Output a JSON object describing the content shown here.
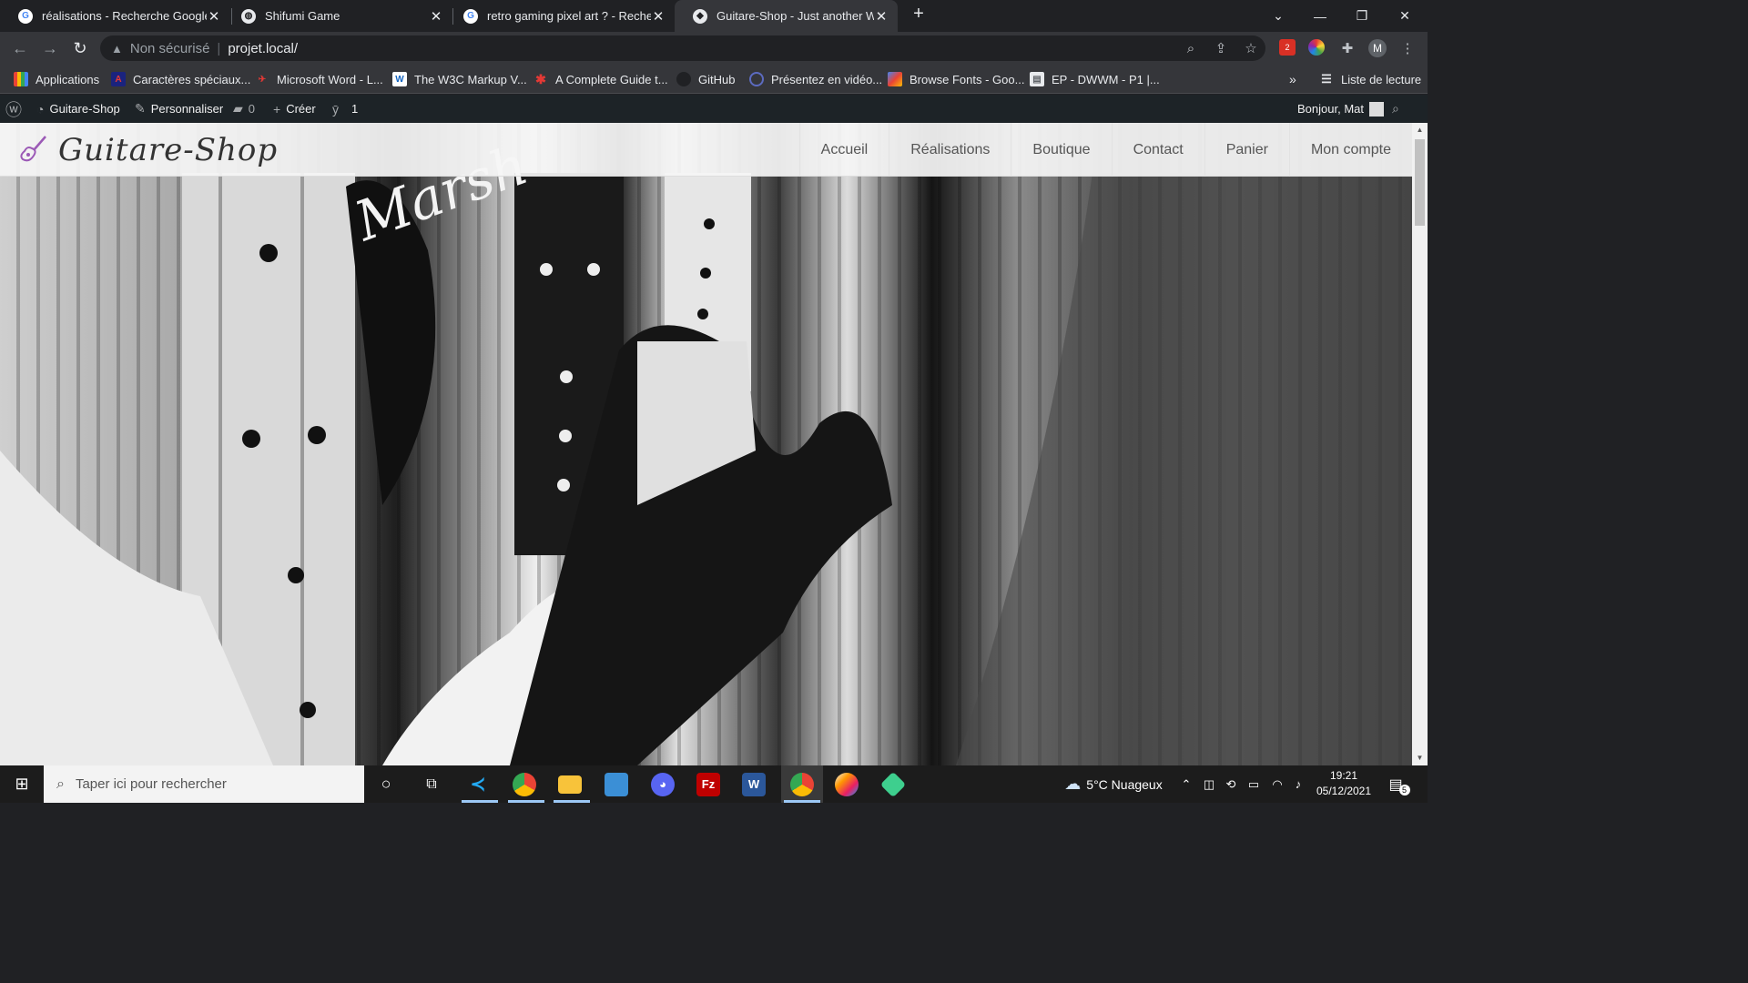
{
  "browser": {
    "tabs": [
      {
        "title": "réalisations - Recherche Google",
        "favicon": "google-icon"
      },
      {
        "title": "Shifumi Game",
        "favicon": "globe-icon"
      },
      {
        "title": "retro gaming pixel art ? - Recherche Google",
        "favicon": "google-icon"
      },
      {
        "title": "Guitare-Shop - Just another WordPress site",
        "favicon": "shield-icon",
        "active": true
      }
    ],
    "new_tab": "+",
    "address": {
      "security_label": "Non sécurisé",
      "url": "projet.local/"
    },
    "bookmarks": [
      {
        "label": "Applications",
        "icon": "apps-grid-icon"
      },
      {
        "label": "Caractères spéciaux...",
        "icon": "letter-a-icon"
      },
      {
        "label": "Microsoft Word - L...",
        "icon": "word-icon"
      },
      {
        "label": "The W3C Markup V...",
        "icon": "w3c-icon"
      },
      {
        "label": "A Complete Guide t...",
        "icon": "star-icon"
      },
      {
        "label": "GitHub",
        "icon": "github-icon"
      },
      {
        "label": "Présentez en vidéo...",
        "icon": "circle-icon"
      },
      {
        "label": "Browse Fonts - Goo...",
        "icon": "fonts-icon"
      },
      {
        "label": "EP - DWWM - P1 |...",
        "icon": "doc-icon"
      }
    ],
    "bookmarks_overflow": "»",
    "reading_list": "Liste de lecture",
    "profile_initial": "M",
    "extension_badge": "2"
  },
  "wp_admin_bar": {
    "site_name": "Guitare-Shop",
    "customize": "Personnaliser",
    "comments_count": "0",
    "new_label": "Créer",
    "yoast_count": "1",
    "greeting": "Bonjour, Mat"
  },
  "site": {
    "logo_text": "Guitare-Shop",
    "nav": [
      "Accueil",
      "Réalisations",
      "Boutique",
      "Contact",
      "Panier",
      "Mon compte"
    ],
    "hero_overlay_text": "Marsh"
  },
  "taskbar": {
    "search_placeholder": "Taper ici pour rechercher",
    "weather": "5°C  Nuageux",
    "time": "19:21",
    "date": "05/12/2021",
    "notification_count": "5",
    "apps": [
      "vscode-icon",
      "chrome-icon",
      "file-explorer-icon",
      "photos-icon",
      "discord-icon",
      "filezilla-icon",
      "word-icon",
      "chrome-profile-icon",
      "paint-icon",
      "app-green-icon"
    ]
  },
  "colors": {
    "browser_dark": "#202124",
    "toolbar": "#35363a",
    "wp_bar": "#1d2327",
    "logo_accent": "#9b59b6"
  }
}
